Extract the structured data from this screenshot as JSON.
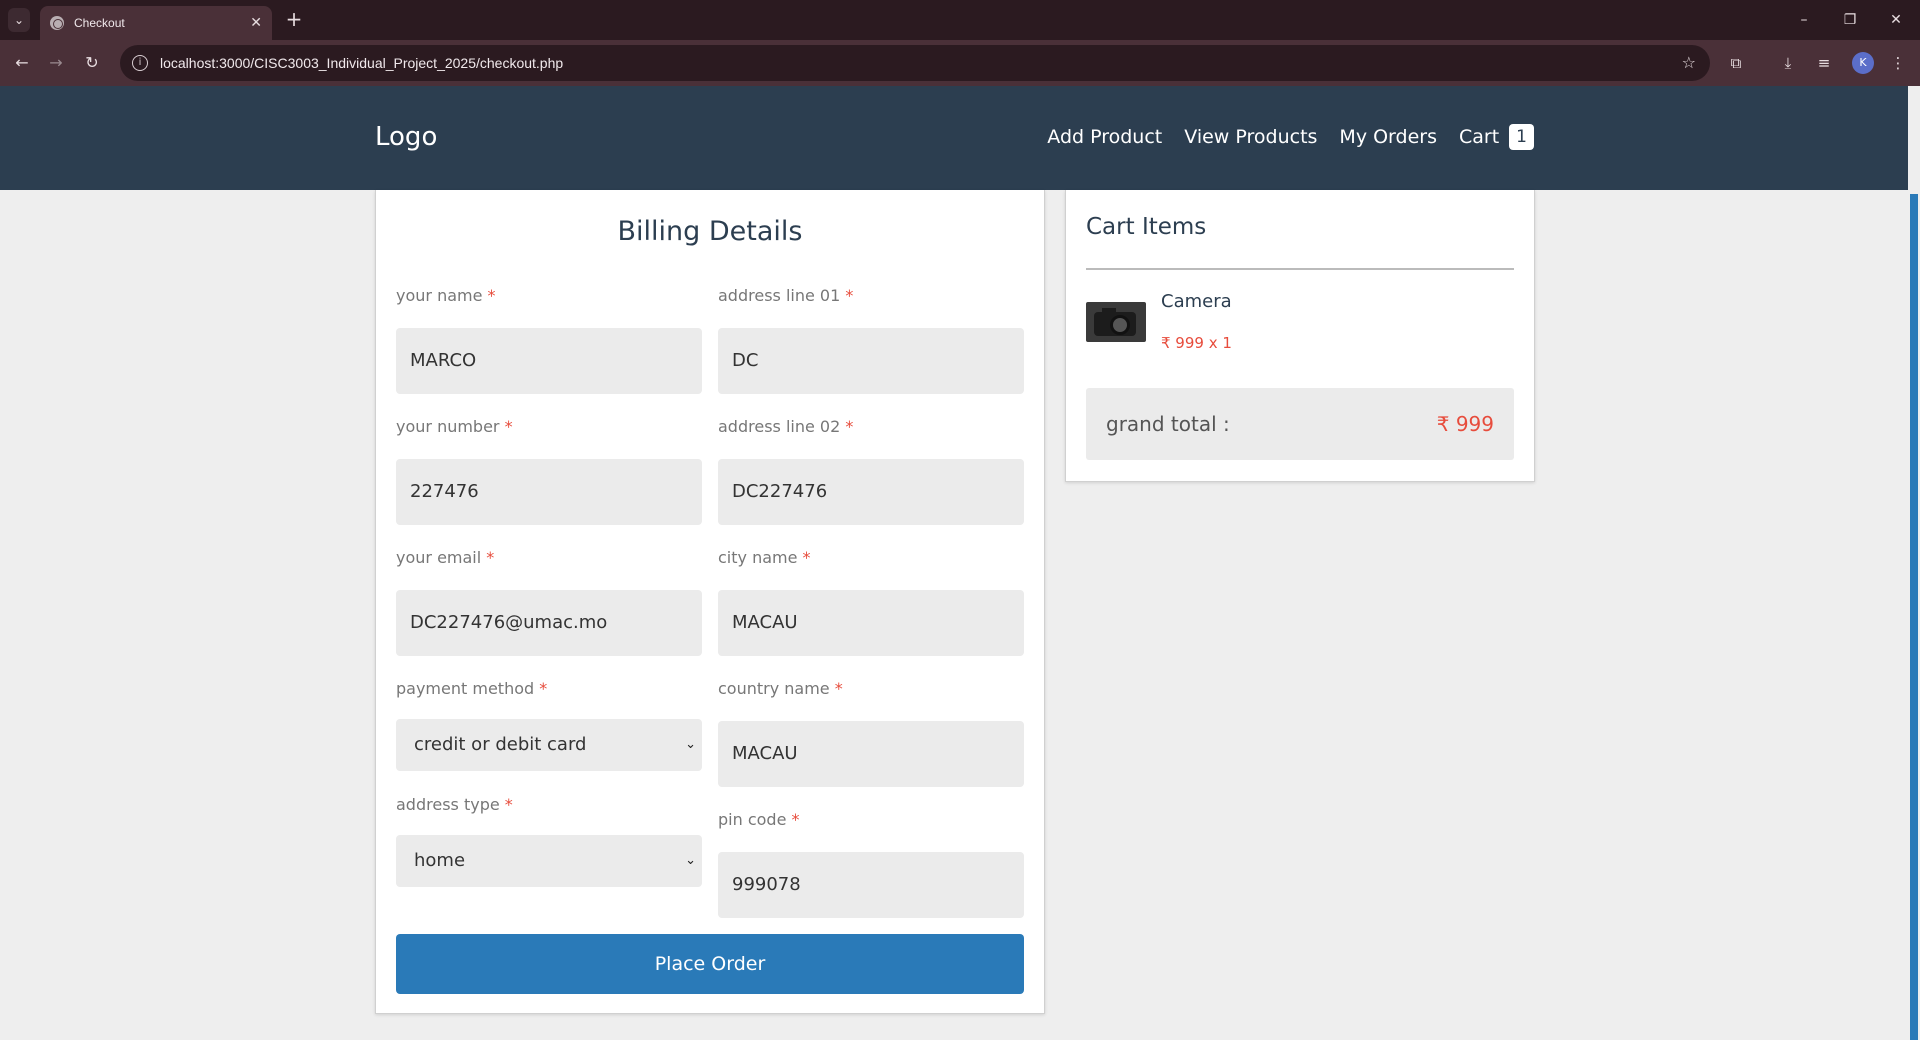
{
  "browser": {
    "tab_title": "Checkout",
    "url": "localhost:3000/CISC3003_Individual_Project_2025/checkout.php",
    "profile_initial": "K"
  },
  "header": {
    "logo": "Logo",
    "nav": {
      "add_product": "Add Product",
      "view_products": "View Products",
      "my_orders": "My Orders",
      "cart": "Cart",
      "cart_count": "1"
    }
  },
  "billing": {
    "title": "Billing Details",
    "required_mark": "*",
    "fields": {
      "name": {
        "label": "your name",
        "value": "MARCO"
      },
      "address1": {
        "label": "address line 01",
        "value": "DC"
      },
      "number": {
        "label": "your number",
        "value": "227476"
      },
      "address2": {
        "label": "address line 02",
        "value": "DC227476"
      },
      "email": {
        "label": "your email",
        "value": "DC227476@umac.mo"
      },
      "city": {
        "label": "city name",
        "value": "MACAU"
      },
      "payment": {
        "label": "payment method",
        "value": "credit or debit card"
      },
      "country": {
        "label": "country name",
        "value": "MACAU"
      },
      "address_type": {
        "label": "address type",
        "value": "home"
      },
      "pin": {
        "label": "pin code",
        "value": "999078"
      }
    },
    "submit_label": "Place Order"
  },
  "cart": {
    "title": "Cart Items",
    "item": {
      "name": "Camera",
      "price_line": "₹ 999 x 1"
    },
    "grand_total_label": "grand total :",
    "grand_total_value": "₹ 999"
  },
  "colors": {
    "header_bg": "#2c3e50",
    "accent": "#2a7ab8",
    "price_red": "#e74c3c"
  }
}
